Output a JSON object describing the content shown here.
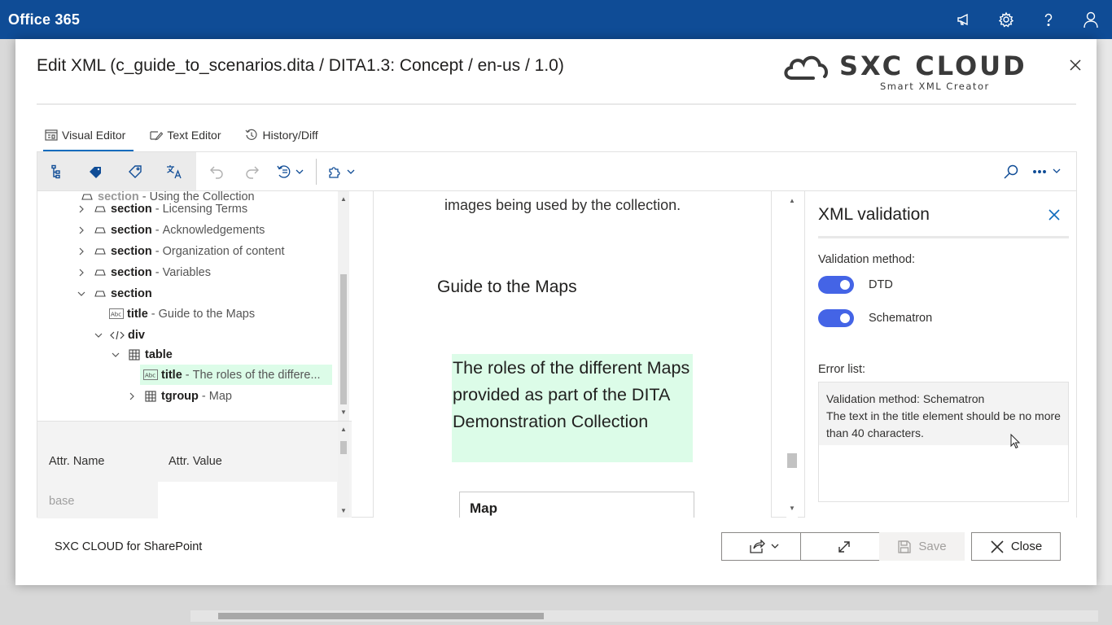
{
  "suitebar": {
    "brand": "Office 365",
    "icons": [
      "megaphone-icon",
      "gear-icon",
      "help-icon",
      "person-icon"
    ],
    "color": "#0f4c96"
  },
  "dialog": {
    "title": "Edit XML (c_guide_to_scenarios.dita / DITA1.3: Concept / en-us / 1.0)",
    "logo": {
      "name": "SXC CLOUD",
      "tagline": "Smart XML Creator"
    }
  },
  "tabs": [
    {
      "label": "Visual Editor",
      "icon": "visual-editor-icon",
      "active": true
    },
    {
      "label": "Text Editor",
      "icon": "text-editor-icon",
      "active": false
    },
    {
      "label": "History/Diff",
      "icon": "history-icon",
      "active": false
    }
  ],
  "tree": {
    "rows": [
      {
        "element": "section",
        "sep": "-",
        "label": "Licensing Terms",
        "expanded": false
      },
      {
        "element": "section",
        "sep": "-",
        "label": "Acknowledgements",
        "expanded": false
      },
      {
        "element": "section",
        "sep": "-",
        "label": "Organization of content",
        "expanded": false
      },
      {
        "element": "section",
        "sep": "-",
        "label": "Variables",
        "expanded": false
      },
      {
        "element": "section",
        "sep": "",
        "label": "",
        "expanded": true
      },
      {
        "element": "title",
        "sep": "-",
        "label": "Guide to the Maps"
      },
      {
        "element": "div",
        "sep": "",
        "label": "",
        "expanded": true
      },
      {
        "element": "table",
        "sep": "",
        "label": "",
        "expanded": true
      },
      {
        "element": "title",
        "sep": "-",
        "label": "The roles of the differe...",
        "selected": true
      },
      {
        "element": "tgroup",
        "sep": "-",
        "label": "Map",
        "expanded": false
      }
    ]
  },
  "attributes": {
    "headers": {
      "name": "Attr. Name",
      "value": "Attr. Value"
    },
    "rows": [
      {
        "name": "base",
        "value": ""
      }
    ]
  },
  "document": {
    "text1": "images being used by the collection.",
    "heading": "Guide to the Maps",
    "caption": "The roles of the different Maps provided as part of the DITA Demonstration Collection",
    "table_header": "Map",
    "highlight_color": "#dcfce8"
  },
  "validation": {
    "title": "XML validation",
    "method_label": "Validation method:",
    "methods": [
      {
        "label": "DTD",
        "enabled": true
      },
      {
        "label": "Schematron",
        "enabled": true
      }
    ],
    "error_list_label": "Error list:",
    "error": {
      "method": "Validation method: Schematron",
      "message": "The text in the title element should be no more than 40 characters."
    },
    "toggle_color": "#4464e6"
  },
  "footer": {
    "label": "SXC CLOUD for SharePoint",
    "save_label": "Save",
    "close_label": "Close"
  }
}
